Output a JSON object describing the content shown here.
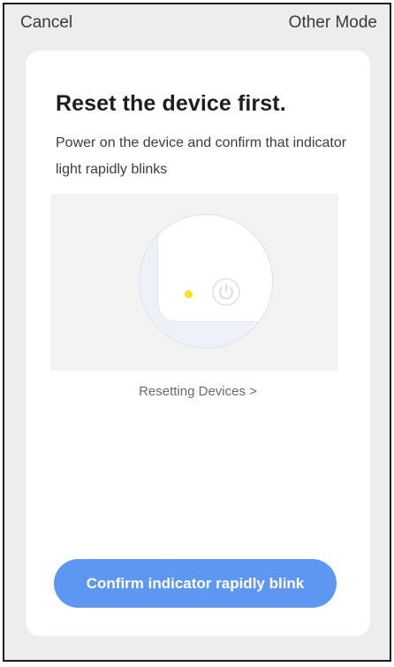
{
  "nav": {
    "cancel_label": "Cancel",
    "other_mode_label": "Other Mode"
  },
  "card": {
    "title": "Reset the device first.",
    "description": "Power on the device and confirm that indicator light rapidly blinks",
    "illustration": {
      "indicator_color": "#f7e21b",
      "icon": "power-icon"
    },
    "reset_link_label": "Resetting Devices >",
    "confirm_button_label": "Confirm indicator rapidly blink"
  },
  "colors": {
    "accent": "#5e97f1",
    "background": "#ededed",
    "card": "#ffffff"
  }
}
